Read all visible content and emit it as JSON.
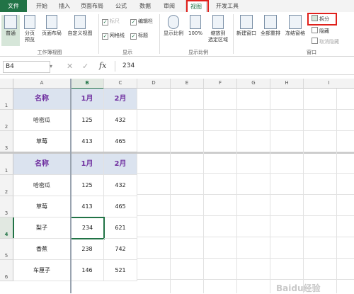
{
  "tabs": {
    "file": "文件",
    "home": "开始",
    "insert": "插入",
    "layout": "页面布局",
    "formula": "公式",
    "data": "数据",
    "review": "审阅",
    "view": "视图",
    "developer": "开发工具"
  },
  "ribbon": {
    "normal": "普通",
    "page_break": "分页\n预览",
    "page_layout": "页面布局",
    "custom_view": "自定义视图",
    "ruler": "标尺",
    "formula_bar": "编辑栏",
    "gridlines": "网格线",
    "headings": "标题",
    "zoom": "显示比例",
    "zoom100": "100%",
    "zoom_sel": "缩放到\n选定区域",
    "new_window": "新建窗口",
    "arrange_all": "全部重排",
    "freeze": "冻结窗格",
    "split": "拆分",
    "hide": "隐藏",
    "unhide": "取消隐藏",
    "group_views": "工作簿视图",
    "group_show": "显示",
    "group_zoom": "显示比例",
    "group_window": "窗口"
  },
  "formula_bar": {
    "name_box": "B4",
    "value": "234",
    "fx": "fx"
  },
  "columns": [
    "A",
    "B",
    "C",
    "D",
    "E",
    "F",
    "G",
    "H",
    "I"
  ],
  "top_pane": {
    "header": [
      "名称",
      "1月",
      "2月"
    ],
    "rows": [
      {
        "num": "1",
        "name": "",
        "jan": "",
        "feb": ""
      },
      {
        "num": "2",
        "name": "哈密瓜",
        "jan": "125",
        "feb": "432"
      },
      {
        "num": "3",
        "name": "草莓",
        "jan": "413",
        "feb": "465"
      }
    ]
  },
  "bottom_pane": {
    "header": [
      "名称",
      "1月",
      "2月"
    ],
    "rows": [
      {
        "num": "1",
        "name": "",
        "jan": "",
        "feb": ""
      },
      {
        "num": "2",
        "name": "哈密瓜",
        "jan": "125",
        "feb": "432"
      },
      {
        "num": "3",
        "name": "草莓",
        "jan": "413",
        "feb": "465"
      },
      {
        "num": "4",
        "name": "梨子",
        "jan": "234",
        "feb": "621"
      },
      {
        "num": "5",
        "name": "香蕉",
        "jan": "238",
        "feb": "742"
      },
      {
        "num": "6",
        "name": "车厘子",
        "jan": "146",
        "feb": "521"
      }
    ]
  },
  "watermark": "Baidu经验",
  "colors": {
    "accent": "#217346",
    "highlight": "#e0211c",
    "header_fill": "#dbe3ef",
    "header_text": "#7030a0"
  }
}
